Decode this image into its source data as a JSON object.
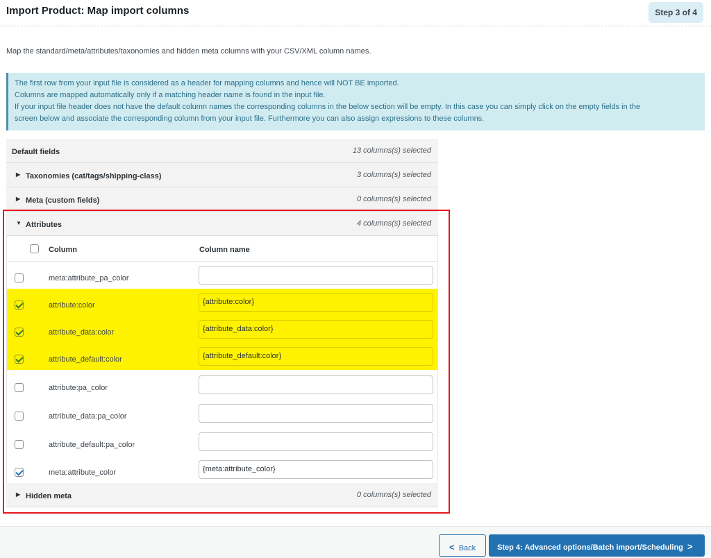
{
  "header": {
    "title": "Import Product: Map import columns",
    "step": "Step 3 of 4"
  },
  "intro": "Map the standard/meta/attributes/taxonomies and hidden meta columns with your CSV/XML column names.",
  "notice": {
    "lines": [
      "The first row from your input file is considered as a header for mapping columns and hence will NOT BE imported.",
      "Columns are mapped automatically only if a matching header name is found in the input file.",
      "If your input file header does not have the default column names the corresponding columns in the below section will be empty. In this case you can simply click on the empty fields in the",
      "screen below and associate the corresponding column from your input file. Furthermore you can also assign expressions to these columns."
    ]
  },
  "sections": [
    {
      "label": "Default fields",
      "count": "13 columns(s) selected",
      "expanded": null
    },
    {
      "label": "Taxonomies (cat/tags/shipping-class)",
      "count": "3 columns(s) selected",
      "expanded": false
    },
    {
      "label": "Meta (custom fields)",
      "count": "0 columns(s) selected",
      "expanded": false
    },
    {
      "label": "Attributes",
      "count": "4 columns(s) selected",
      "expanded": true
    },
    {
      "label": "Hidden meta",
      "count": "0 columns(s) selected",
      "expanded": false
    }
  ],
  "attributes_table": {
    "headers": {
      "column": "Column",
      "column_name": "Column name"
    },
    "rows": [
      {
        "column": "meta:attribute_pa_color",
        "value": "",
        "checked": false,
        "highlighted": false
      },
      {
        "column": "attribute:color",
        "value": "{attribute:color}",
        "checked": true,
        "highlighted": true
      },
      {
        "column": "attribute_data:color",
        "value": "{attribute_data:color}",
        "checked": true,
        "highlighted": true
      },
      {
        "column": "attribute_default:color",
        "value": "{attribute_default:color}",
        "checked": true,
        "highlighted": true
      },
      {
        "column": "attribute:pa_color",
        "value": "",
        "checked": false,
        "highlighted": false
      },
      {
        "column": "attribute_data:pa_color",
        "value": "",
        "checked": false,
        "highlighted": false
      },
      {
        "column": "attribute_default:pa_color",
        "value": "",
        "checked": false,
        "highlighted": false
      },
      {
        "column": "meta:attribute_color",
        "value": "{meta:attribute_color}",
        "checked": true,
        "highlighted": false
      }
    ]
  },
  "footer": {
    "back_label": "Back",
    "next_label": "Step 4: Advanced options/Batch import/Scheduling"
  },
  "colors": {
    "highlight": "#fff200",
    "annotation_box": "#e8141b",
    "primary": "#2271b1",
    "notice_bg": "#d1ecf1"
  }
}
